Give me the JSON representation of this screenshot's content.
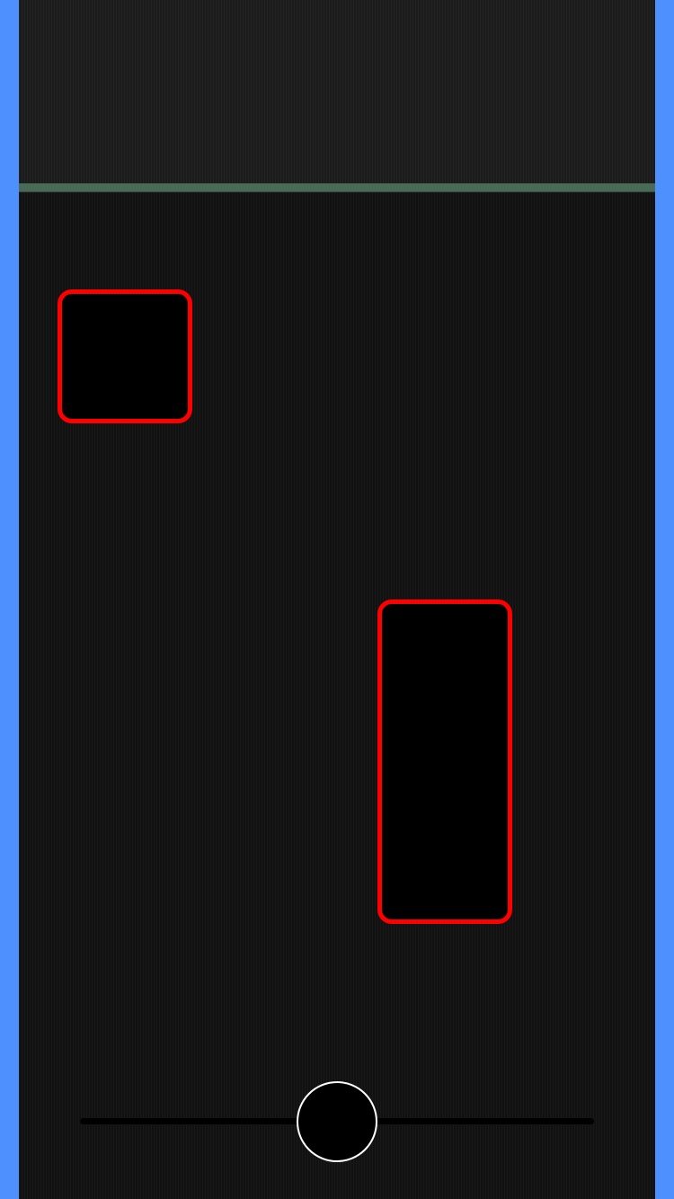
{
  "colors": {
    "outer_background": "#4d90fe",
    "playfield_background": "#111111",
    "top_zone_background": "#1b1b1b",
    "divider": "#4a6a58",
    "obstacle_fill": "#000000",
    "obstacle_border": "#ff0000",
    "slider_track": "#000000",
    "slider_knob_fill": "#000000",
    "slider_knob_border": "#ffffff"
  },
  "obstacles": [
    {
      "id": "block-1",
      "shape": "rounded-square"
    },
    {
      "id": "block-2",
      "shape": "rounded-tall-rectangle"
    }
  ],
  "slider": {
    "position_fraction": 0.5
  }
}
